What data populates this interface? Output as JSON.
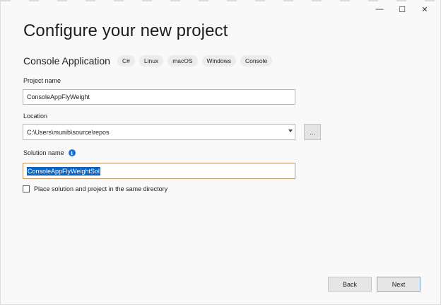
{
  "window": {
    "controls": {
      "minimize": "—",
      "maximize": "☐",
      "close": "✕"
    }
  },
  "page": {
    "title": "Configure your new project"
  },
  "template": {
    "name": "Console Application",
    "tags": [
      "C#",
      "Linux",
      "macOS",
      "Windows",
      "Console"
    ]
  },
  "project_name": {
    "label": "Project name",
    "value": "ConsoleAppFlyWeight"
  },
  "location": {
    "label": "Location",
    "value": "C:\\Users\\munib\\source\\repos",
    "browse_label": "..."
  },
  "solution_name": {
    "label": "Solution name",
    "info_icon": "i",
    "value": "ConsoleAppFlyWeightSol"
  },
  "same_directory": {
    "label": "Place solution and project in the same directory",
    "checked": false
  },
  "footer": {
    "back_label": "Back",
    "next_label": "Next"
  }
}
